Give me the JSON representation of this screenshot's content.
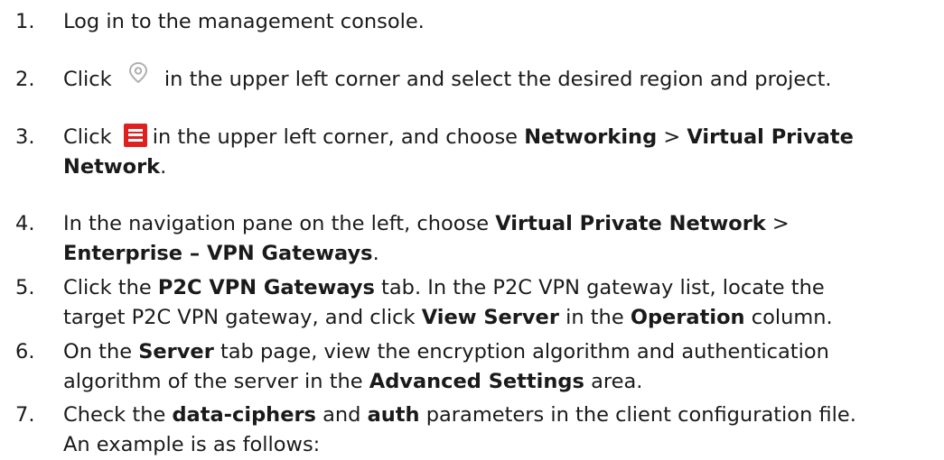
{
  "steps": [
    {
      "num": "1.",
      "lines": [
        [
          {
            "t": "Log in to the management console."
          }
        ]
      ]
    },
    {
      "num": "2.",
      "lines": [
        [
          {
            "t": "Click "
          },
          {
            "icon": "location"
          },
          {
            "t": " in the upper left corner and select the desired region and project."
          }
        ]
      ]
    },
    {
      "num": "3.",
      "lines": [
        [
          {
            "t": "Click "
          },
          {
            "icon": "menu"
          },
          {
            "t": "in the upper left corner, and choose "
          },
          {
            "t": "Networking",
            "b": true
          },
          {
            "t": " > "
          },
          {
            "t": "Virtual Private",
            "b": true
          }
        ],
        [
          {
            "t": "Network",
            "b": true
          },
          {
            "t": "."
          }
        ]
      ]
    },
    {
      "num": "4.",
      "lines": [
        [
          {
            "t": "In the navigation pane on the left, choose "
          },
          {
            "t": "Virtual Private Network",
            "b": true
          },
          {
            "t": " >"
          }
        ],
        [
          {
            "t": "Enterprise – VPN Gateways",
            "b": true
          },
          {
            "t": "."
          }
        ]
      ]
    },
    {
      "num": "5.",
      "lines": [
        [
          {
            "t": "Click the "
          },
          {
            "t": "P2C VPN Gateways",
            "b": true
          },
          {
            "t": " tab. In the P2C VPN gateway list, locate the"
          }
        ],
        [
          {
            "t": "target P2C VPN gateway, and click "
          },
          {
            "t": "View Server",
            "b": true
          },
          {
            "t": " in the "
          },
          {
            "t": "Operation",
            "b": true
          },
          {
            "t": " column."
          }
        ]
      ]
    },
    {
      "num": "6.",
      "lines": [
        [
          {
            "t": "On the "
          },
          {
            "t": "Server",
            "b": true
          },
          {
            "t": " tab page, view the encryption algorithm and authentication"
          }
        ],
        [
          {
            "t": "algorithm of the server in the "
          },
          {
            "t": "Advanced Settings",
            "b": true
          },
          {
            "t": " area."
          }
        ]
      ]
    },
    {
      "num": "7.",
      "lines": [
        [
          {
            "t": "Check the "
          },
          {
            "t": "data-ciphers",
            "b": true
          },
          {
            "t": " and "
          },
          {
            "t": "auth",
            "b": true
          },
          {
            "t": " parameters in the client configuration file."
          }
        ],
        [
          {
            "t": "An example is as follows:"
          }
        ]
      ]
    }
  ],
  "colors": {
    "text": "#1a1a1a",
    "menu_icon_bg": "#e0201f",
    "location_icon_stroke": "#b0b0b0"
  }
}
